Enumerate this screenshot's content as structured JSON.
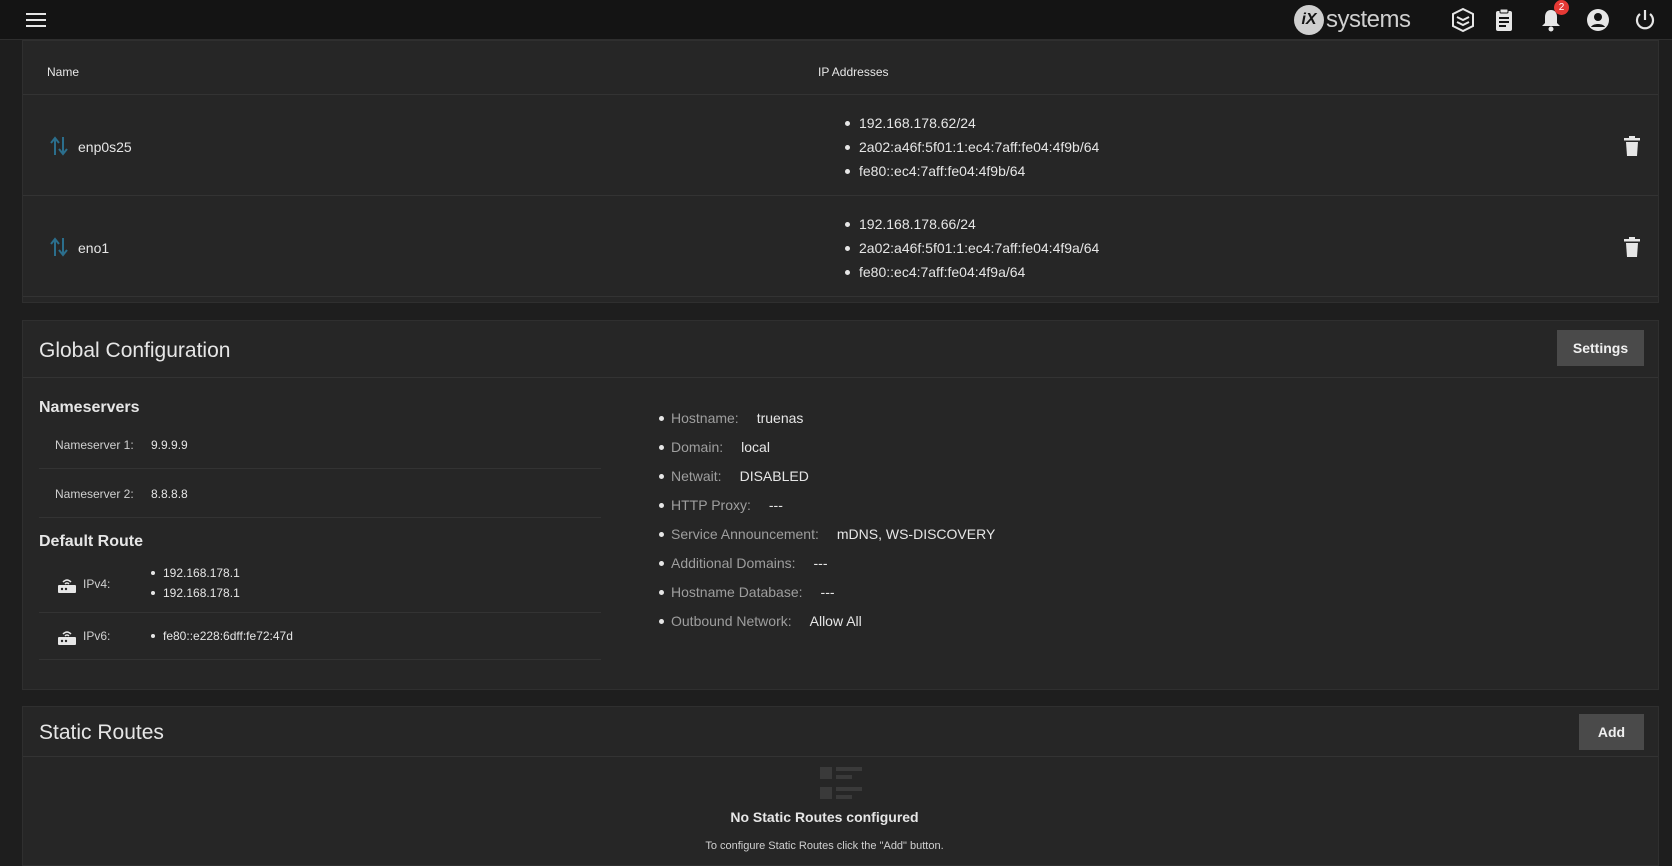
{
  "topbar": {
    "logo_mark": "iX",
    "logo_text": "systems",
    "notification_count": "2",
    "icons": [
      "menu-icon",
      "truecommand-icon",
      "clipboard-icon",
      "bell-icon",
      "account-icon",
      "power-icon"
    ]
  },
  "interfaces": {
    "col_name": "Name",
    "col_ip": "IP Addresses",
    "rows": [
      {
        "name": "enp0s25",
        "ips": [
          "192.168.178.62/24",
          "2a02:a46f:5f01:1:ec4:7aff:fe04:4f9b/64",
          "fe80::ec4:7aff:fe04:4f9b/64"
        ]
      },
      {
        "name": "eno1",
        "ips": [
          "192.168.178.66/24",
          "2a02:a46f:5f01:1:ec4:7aff:fe04:4f9a/64",
          "fe80::ec4:7aff:fe04:4f9a/64"
        ]
      }
    ]
  },
  "global": {
    "title": "Global Configuration",
    "settings_label": "Settings",
    "nameservers_heading": "Nameservers",
    "nameservers": [
      {
        "label": "Nameserver 1:",
        "value": "9.9.9.9"
      },
      {
        "label": "Nameserver 2:",
        "value": "8.8.8.8"
      }
    ],
    "default_route_heading": "Default Route",
    "ipv4": {
      "label": "IPv4:",
      "values": [
        "192.168.178.1",
        "192.168.178.1"
      ]
    },
    "ipv6": {
      "label": "IPv6:",
      "values": [
        "fe80::e228:6dff:fe72:47d"
      ]
    },
    "config": [
      {
        "key": "Hostname:",
        "value": "truenas"
      },
      {
        "key": "Domain:",
        "value": "local"
      },
      {
        "key": "Netwait:",
        "value": "DISABLED"
      },
      {
        "key": "HTTP Proxy:",
        "value": "---"
      },
      {
        "key": "Service Announcement:",
        "value": "mDNS, WS-DISCOVERY"
      },
      {
        "key": "Additional Domains:",
        "value": "---"
      },
      {
        "key": "Hostname Database:",
        "value": "---"
      },
      {
        "key": "Outbound Network:",
        "value": "Allow All"
      }
    ]
  },
  "static_routes": {
    "title": "Static Routes",
    "add_label": "Add",
    "empty_title": "No Static Routes configured",
    "empty_message": "To configure Static Routes click the \"Add\" button."
  },
  "colors": {
    "background": "#1e1e1e",
    "card": "#262626",
    "topbar": "#141414",
    "accent_icon": "#2b6e8c",
    "badge": "#e53935"
  }
}
